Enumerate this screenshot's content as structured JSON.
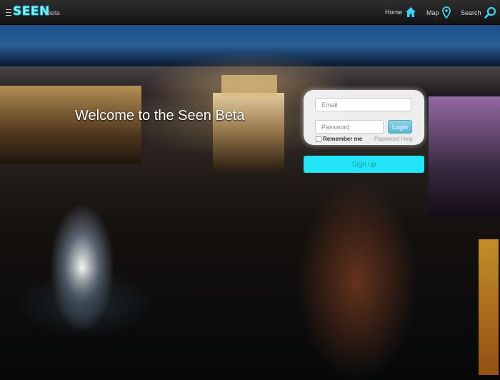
{
  "app": {
    "logo": "SEEN",
    "badge": "beta"
  },
  "nav": {
    "home": "Home",
    "map": "Map",
    "search": "Search"
  },
  "hero": {
    "welcome": "Welcome to the Seen Beta"
  },
  "login": {
    "email_placeholder": "Email",
    "password_placeholder": "Password",
    "login_label": "Login",
    "remember_label": "Remember me",
    "password_help": "Password Help",
    "signup_label": "Sign up"
  },
  "colors": {
    "accent": "#22e6f7",
    "logo": "#7ff2ff",
    "nav_icon": "#39d6f2"
  },
  "icons": {
    "menu": "menu-icon",
    "home": "home-icon",
    "map": "map-pin-icon",
    "search": "search-icon"
  }
}
